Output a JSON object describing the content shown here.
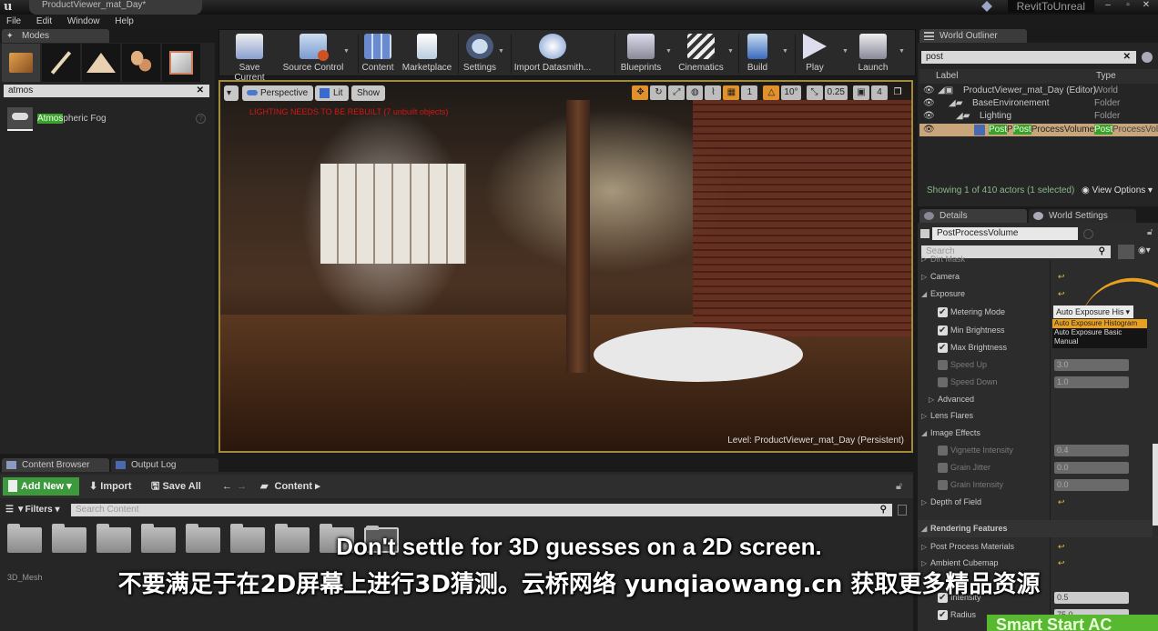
{
  "window": {
    "doc_tab": "ProductViewer_mat_Day*",
    "project_name": "RevitToUnreal",
    "controls": [
      "minimize",
      "maximize",
      "close"
    ]
  },
  "menu": [
    "File",
    "Edit",
    "Window",
    "Help"
  ],
  "modes": {
    "tab": "Modes",
    "icons": [
      "place-icon",
      "paint-icon",
      "landscape-icon",
      "foliage-icon",
      "geometry-icon"
    ],
    "search_value": "atmos",
    "results": [
      {
        "label_match": "Atmos",
        "label_rest": "pheric Fog"
      }
    ]
  },
  "toolbar": {
    "buttons": [
      {
        "label": "Save Current",
        "icon": "save-icon"
      },
      {
        "label": "Source Control",
        "icon": "source-control-icon"
      },
      {
        "label": "Content",
        "icon": "content-icon"
      },
      {
        "label": "Marketplace",
        "icon": "marketplace-icon"
      },
      {
        "label": "Settings",
        "icon": "settings-icon"
      },
      {
        "label": "Import Datasmith...",
        "icon": "datasmith-icon"
      },
      {
        "label": "Blueprints",
        "icon": "blueprints-icon"
      },
      {
        "label": "Cinematics",
        "icon": "cinematics-icon"
      },
      {
        "label": "Build",
        "icon": "build-icon"
      },
      {
        "label": "Play",
        "icon": "play-icon"
      },
      {
        "label": "Launch",
        "icon": "launch-icon"
      }
    ]
  },
  "viewport": {
    "perspective": "Perspective",
    "lit": "Lit",
    "show": "Show",
    "warning": "LIGHTING NEEDS TO BE REBUILT (7 unbuilt objects)",
    "grid_snap": "1",
    "rotation_snap": "10°",
    "scale_snap": "0.25",
    "camera_speed": "4",
    "level_label": "Level:",
    "level_name": "ProductViewer_mat_Day (Persistent)"
  },
  "content_browser": {
    "tabs": [
      "Content Browser",
      "Output Log"
    ],
    "add_new": "Add New",
    "import": "Import",
    "save_all": "Save All",
    "path": "Content",
    "filters": "Filters",
    "search_placeholder": "Search Content",
    "first_folder": "3D_Mesh",
    "folder_count": 9
  },
  "outliner": {
    "tab": "World Outliner",
    "search_value": "post",
    "col_label": "Label",
    "col_type": "Type",
    "rows": [
      {
        "label": "ProductViewer_mat_Day (Editor)",
        "type": "World"
      },
      {
        "label": "BaseEnvironement",
        "type": "Folder"
      },
      {
        "label": "Lighting",
        "type": "Folder"
      },
      {
        "label": "PostPostProcessVolume",
        "type": "PostProcessVolume"
      }
    ],
    "status": "Showing 1 of 410 actors (1 selected)",
    "view_options": "View Options"
  },
  "details": {
    "tabs": [
      "Details",
      "World Settings"
    ],
    "name_value": "PostProcessVolume",
    "search_placeholder": "Search",
    "rows": {
      "dirt_mask": "Dirt Mask",
      "camera": "Camera",
      "exposure": "Exposure",
      "metering_mode": "Metering Mode",
      "min_brightness": "Min Brightness",
      "max_brightness": "Max Brightness",
      "speed_up": "Speed Up",
      "speed_up_val": "3.0",
      "speed_down": "Speed Down",
      "speed_down_val": "1.0",
      "advanced": "Advanced",
      "lens_flares": "Lens Flares",
      "image_effects": "Image Effects",
      "vignette": "Vignette Intensity",
      "vignette_val": "0.4",
      "grain_jitter": "Grain Jitter",
      "grain_jitter_val": "0.0",
      "grain_intensity": "Grain Intensity",
      "grain_intensity_val": "0.0",
      "dof": "Depth of Field",
      "rendering_features": "Rendering Features",
      "pp_materials": "Post Process Materials",
      "ambient_cubemap": "Ambient Cubemap",
      "intensity": "Intensity",
      "intensity_val": "0.5",
      "radius": "Radius",
      "radius_val": "75.0"
    },
    "metering_selected": "Auto Exposure His",
    "metering_options": [
      "Auto Exposure Histogram",
      "Auto Exposure Basic",
      "Manual"
    ]
  },
  "subtitles": {
    "en": "Don't settle for 3D guesses on a 2D screen.",
    "cn": "不要满足于在2D屏幕上进行3D猜测。云桥网络 yunqiaowang.cn  获取更多精品资源"
  },
  "banner": "Smart Start AC",
  "colors": {
    "accent_green": "#3c9a3c",
    "highlight": "#3ba02e",
    "dropdown_selected": "#e8a020",
    "warning": "#d01818"
  }
}
